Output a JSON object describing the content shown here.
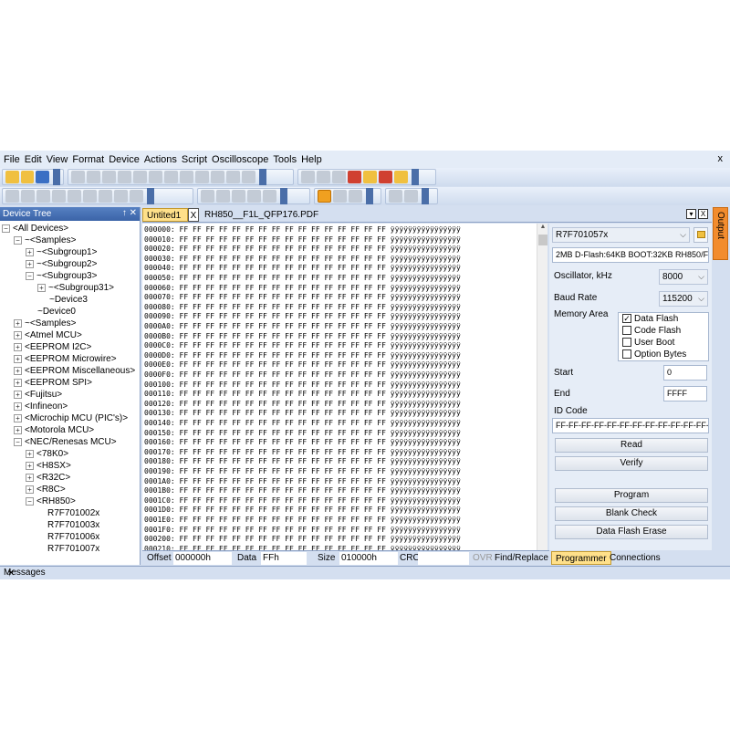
{
  "menu": [
    "File",
    "Edit",
    "View",
    "Format",
    "Device",
    "Actions",
    "Script",
    "Oscilloscope",
    "Tools",
    "Help"
  ],
  "menu_close": "x",
  "device_tree": {
    "title": "Device Tree",
    "pin": "↑",
    "close": "✕",
    "nodes": [
      {
        "label": "<All Devices>",
        "exp": "−"
      },
      {
        "label": "~<Samples>",
        "exp": "−"
      },
      {
        "label": "~<Subgroup1>",
        "exp": "+"
      },
      {
        "label": "~<Subgroup2>",
        "exp": "+"
      },
      {
        "label": "~<Subgroup3>",
        "exp": "−"
      },
      {
        "label": "~<Subgroup31>",
        "exp": "+"
      },
      {
        "label": "~Device3",
        "exp": ""
      },
      {
        "label": "~Device0",
        "exp": ""
      },
      {
        "label": "~<Samples>",
        "exp": "+"
      },
      {
        "label": "<Atmel MCU>",
        "exp": "+"
      },
      {
        "label": "<EEPROM I2C>",
        "exp": "+"
      },
      {
        "label": "<EEPROM Microwire>",
        "exp": "+"
      },
      {
        "label": "<EEPROM Miscellaneous>",
        "exp": "+"
      },
      {
        "label": "<EEPROM SPI>",
        "exp": "+"
      },
      {
        "label": "<Fujitsu>",
        "exp": "+"
      },
      {
        "label": "<Infineon>",
        "exp": "+"
      },
      {
        "label": "<Microchip MCU (PIC's)>",
        "exp": "+"
      },
      {
        "label": "<Motorola MCU>",
        "exp": "+"
      },
      {
        "label": "<NEC/Renesas MCU>",
        "exp": "−"
      },
      {
        "label": "<78K0>",
        "exp": "+"
      },
      {
        "label": "<H8SX>",
        "exp": "+"
      },
      {
        "label": "<R32C>",
        "exp": "+"
      },
      {
        "label": "<R8C>",
        "exp": "+"
      },
      {
        "label": "<RH850>",
        "exp": "−"
      },
      {
        "label": "R7F701002x",
        "exp": ""
      },
      {
        "label": "R7F701003x",
        "exp": ""
      },
      {
        "label": "R7F701006x",
        "exp": ""
      },
      {
        "label": "R7F701007x",
        "exp": ""
      }
    ]
  },
  "doc_tabs": {
    "active": "Untited1",
    "close": "X",
    "other": "RH850__F1L_QFP176.PDF",
    "ctl_menu": "▾",
    "ctl_close": "X"
  },
  "hex": {
    "addresses": [
      "000000:",
      "000010:",
      "000020:",
      "000030:",
      "000040:",
      "000050:",
      "000060:",
      "000070:",
      "000080:",
      "000090:",
      "0000A0:",
      "0000B0:",
      "0000C0:",
      "0000D0:",
      "0000E0:",
      "0000F0:",
      "000100:",
      "000110:",
      "000120:",
      "000130:",
      "000140:",
      "000150:",
      "000160:",
      "000170:",
      "000180:",
      "000190:",
      "0001A0:",
      "0001B0:",
      "0001C0:",
      "0001D0:",
      "0001E0:",
      "0001F0:",
      "000200:",
      "000210:"
    ],
    "bytes": "FF FF FF FF FF FF FF FF FF FF FF FF FF FF FF FF",
    "ascii": "ÿÿÿÿÿÿÿÿÿÿÿÿÿÿÿÿ"
  },
  "status": {
    "offset_label": "Offset",
    "offset_value": "000000h",
    "data_label": "Data",
    "data_value": "FFh",
    "size_label": "Size",
    "size_value": "010000h",
    "crc_label": "CRC",
    "crc_value": "",
    "ovr": "OVR",
    "find": "Find/Replace"
  },
  "programmer": {
    "device": "R7F701057x",
    "description": "2MB D-Flash:64KB BOOT:32KB RH850/F1L",
    "oscillator_label": "Oscillator, kHz",
    "oscillator_value": "8000",
    "baud_label": "Baud Rate",
    "baud_value": "115200",
    "memory_label": "Memory Area",
    "memory_areas": [
      {
        "label": "Data Flash",
        "checked": true
      },
      {
        "label": "Code Flash",
        "checked": false
      },
      {
        "label": "User Boot",
        "checked": false
      },
      {
        "label": "Option Bytes",
        "checked": false
      }
    ],
    "start_label": "Start",
    "start_value": "0",
    "end_label": "End",
    "end_value": "FFFF",
    "id_label": "ID Code",
    "id_value": "FF-FF-FF-FF-FF-FF-FF-FF-FF-FF-FF-FF-FF-FF-F",
    "buttons": [
      "Read",
      "Verify",
      "Program",
      "Blank Check",
      "Data Flash Erase"
    ],
    "tab_programmer": "Programmer",
    "tab_connections": "Connections"
  },
  "output_tab": "Output",
  "messages": {
    "title": "Messages",
    "pin": "↑",
    "close": "✕"
  }
}
